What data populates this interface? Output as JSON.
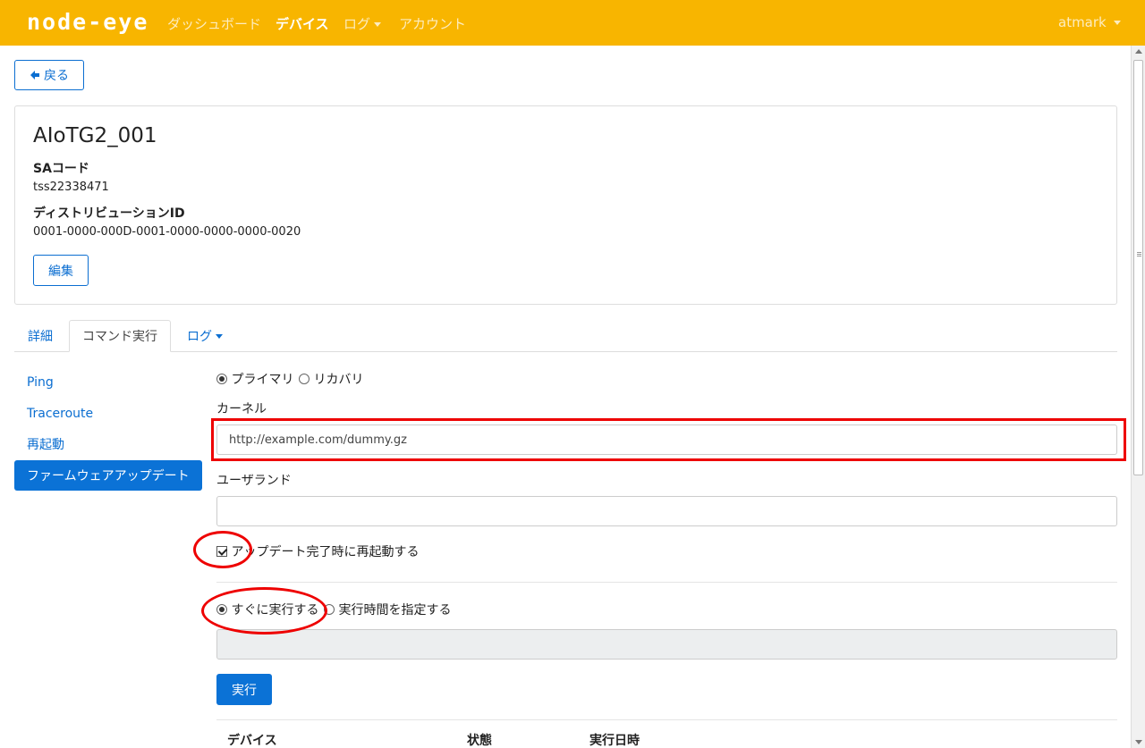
{
  "navbar": {
    "brand": "node-eye",
    "items": [
      {
        "label": "ダッシュボード"
      },
      {
        "label": "デバイス"
      },
      {
        "label": "ログ"
      },
      {
        "label": "アカウント"
      }
    ],
    "user": "atmark",
    "bg_color": "#f8b500"
  },
  "back_button": {
    "label": "戻る",
    "icon": "arrow-left-icon"
  },
  "device": {
    "name": "AIoTG2_001",
    "sa_code_label": "SAコード",
    "sa_code": "tss22338471",
    "distribution_id_label": "ディストリビューションID",
    "distribution_id": "0001-0000-000D-0001-0000-0000-0000-0020",
    "edit_label": "編集"
  },
  "tabs": [
    {
      "label": "詳細"
    },
    {
      "label": "コマンド実行",
      "active": true
    },
    {
      "label": "ログ"
    }
  ],
  "side_nav": [
    {
      "label": "Ping"
    },
    {
      "label": "Traceroute"
    },
    {
      "label": "再起動"
    },
    {
      "label": "ファームウェアアップデート",
      "active": true
    }
  ],
  "firmware_form": {
    "target_primary": "プライマリ",
    "target_recovery": "リカバリ",
    "kernel_label": "カーネル",
    "kernel_value": "http://example.com/dummy.gz",
    "userland_label": "ユーザランド",
    "userland_value": "",
    "reboot_label": "アップデート完了時に再起動する",
    "run_now_label": "すぐに実行する",
    "schedule_label": "実行時間を指定する",
    "schedule_value": "",
    "execute_label": "実行"
  },
  "history_table": {
    "columns": [
      "デバイス",
      "状態",
      "実行日時"
    ]
  },
  "accent_color": "#0b72d6",
  "annotation_color": "#ee0000"
}
